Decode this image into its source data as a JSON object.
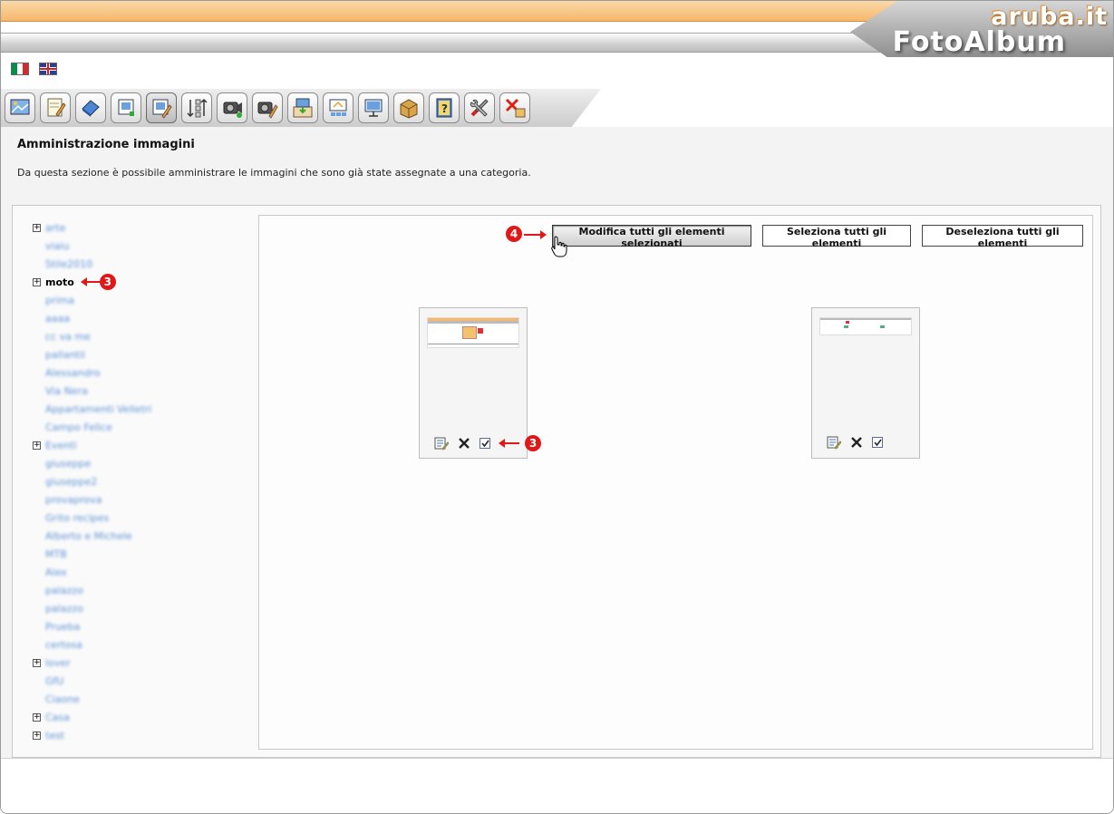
{
  "brand": {
    "small": "aruba.it",
    "big": "FotoAlbum"
  },
  "languages": [
    {
      "name": "italian-flag-icon"
    },
    {
      "name": "english-flag-icon"
    }
  ],
  "toolbar_icons": [
    "add-category-icon",
    "edit-text-icon",
    "manage-categories-icon",
    "upload-image-icon",
    "manage-images-icon",
    "sort-icon",
    "add-video-icon",
    "manage-video-icon",
    "import-icon",
    "thumbnails-icon",
    "slideshow-icon",
    "package-icon",
    "help-icon",
    "settings-icon",
    "logout-icon"
  ],
  "page": {
    "title": "Amministrazione immagini",
    "description": "Da questa sezione è possibile amministrare le immagini che sono già state assegnate a una categoria."
  },
  "tree": [
    {
      "label": "arte",
      "expandable": true
    },
    {
      "label": "viaiu",
      "expandable": false
    },
    {
      "label": "Stile2010",
      "expandable": false
    },
    {
      "label": "moto",
      "expandable": true,
      "selected": true,
      "annotation": "3"
    },
    {
      "label": "prima",
      "expandable": false
    },
    {
      "label": "aaaa",
      "expandable": false
    },
    {
      "label": "cc va me",
      "expandable": false
    },
    {
      "label": "pallantii",
      "expandable": false
    },
    {
      "label": "Alessandro",
      "expandable": false
    },
    {
      "label": "Via Nera",
      "expandable": false
    },
    {
      "label": "Appartamenti Velletri",
      "expandable": false
    },
    {
      "label": "Campo Felice",
      "expandable": false
    },
    {
      "label": "Eventi",
      "expandable": true
    },
    {
      "label": "giuseppe",
      "expandable": false
    },
    {
      "label": "giuseppe2",
      "expandable": false
    },
    {
      "label": "provaprova",
      "expandable": false
    },
    {
      "label": "Grito recipes",
      "expandable": false
    },
    {
      "label": "Alberto e Michele",
      "expandable": false
    },
    {
      "label": "MTB",
      "expandable": false
    },
    {
      "label": "Alex",
      "expandable": false
    },
    {
      "label": "palazzo",
      "expandable": false
    },
    {
      "label": "palazzo",
      "expandable": false
    },
    {
      "label": "Prueba",
      "expandable": false
    },
    {
      "label": "certosa",
      "expandable": false
    },
    {
      "label": "lover",
      "expandable": true
    },
    {
      "label": "GfU",
      "expandable": false
    },
    {
      "label": "Ciaone",
      "expandable": false
    },
    {
      "label": "Casa",
      "expandable": true
    },
    {
      "label": "test",
      "expandable": true
    }
  ],
  "actions": {
    "edit_selected": "Modifica tutti gli elementi selezionati",
    "select_all": "Seleziona tutti gli elementi",
    "deselect_all": "Deseleziona tutti gli elementi",
    "edit_annotation": "4"
  },
  "thumbnails": [
    {
      "checked": true,
      "annotation": "3"
    },
    {
      "checked": true
    }
  ],
  "colors": {
    "top_orange": "#f6b76b",
    "link_blue": "#5f93d8",
    "annotation_red": "#e01818"
  }
}
